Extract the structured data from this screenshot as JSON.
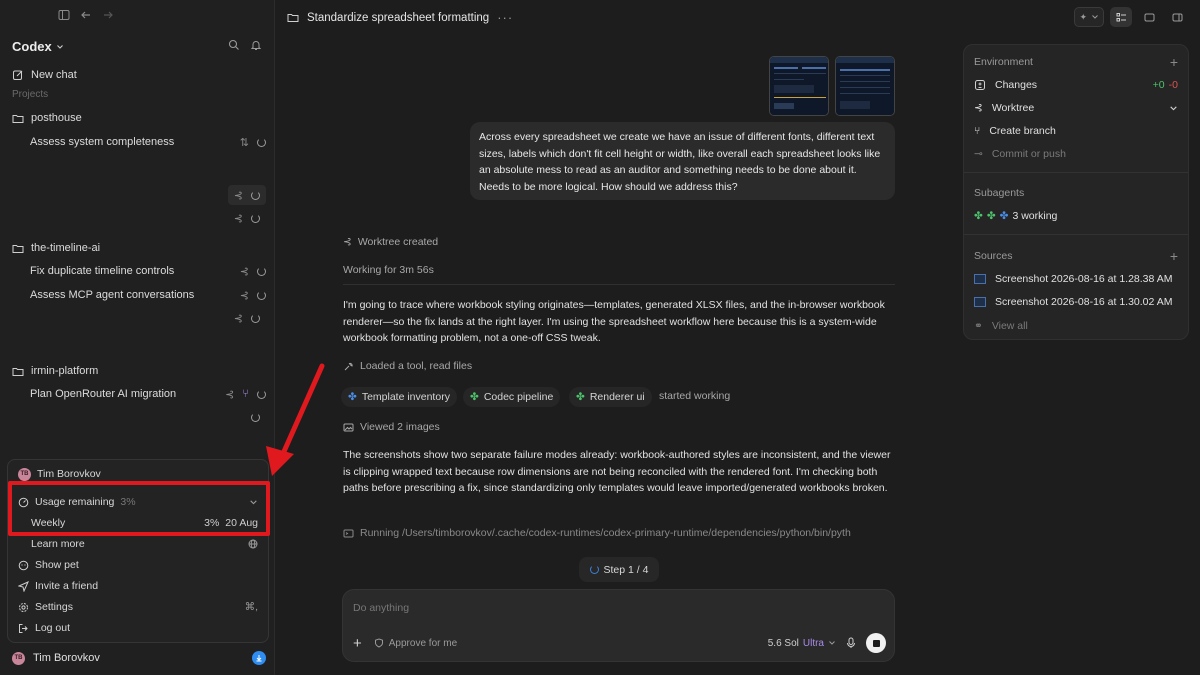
{
  "sidebar": {
    "brand": "Codex",
    "new_chat": "New chat",
    "projects_label": "Projects",
    "groups": [
      {
        "name": "posthouse",
        "items": [
          "Assess system completeness"
        ]
      },
      {
        "name": "the-timeline-ai",
        "items": [
          "Fix duplicate timeline controls",
          "Assess MCP agent conversations"
        ]
      },
      {
        "name": "irmin-platform",
        "items": [
          "Plan OpenRouter AI migration"
        ]
      }
    ],
    "user": "Tim Borovkov",
    "user_initials": "TB"
  },
  "popup": {
    "user": "Tim Borovkov",
    "usage_label": "Usage remaining",
    "usage_pct": "3%",
    "weekly_label": "Weekly",
    "weekly_pct": "3%",
    "weekly_date": "20 Aug",
    "learn_more": "Learn more",
    "show_pet": "Show pet",
    "invite": "Invite a friend",
    "settings": "Settings",
    "settings_shortcut": "⌘,",
    "logout": "Log out"
  },
  "header": {
    "title": "Standardize spreadsheet formatting"
  },
  "chat": {
    "user_message": "Across every spreadsheet we create we have an issue of different fonts, different text sizes, labels which don't fit cell height or width, like overall each spreadsheet looks like an absolute mess to read as an auditor and something needs to be done about it. Needs to be more logical. How should we address this?",
    "worktree_created": "Worktree created",
    "working_for": "Working for 3m 56s",
    "para1": "I'm going to trace where workbook styling originates—templates, generated XLSX files, and the in-browser workbook renderer—so the fix lands at the right layer. I'm using the spreadsheet workflow here because this is a system-wide workbook formatting problem, not a one-off CSS tweak.",
    "loaded_tool": "Loaded a tool, read files",
    "chips": [
      "Template inventory",
      "Codec pipeline",
      "Renderer ui"
    ],
    "started_working": "started working",
    "viewed_images": "Viewed 2 images",
    "para2": "The screenshots show two separate failure modes already: workbook-authored styles are inconsistent, and the viewer is clipping wrapped text because row dimensions are not being reconciled with the rendered font. I'm checking both paths before prescribing a fix, since standardizing only templates would leave imported/generated workbooks broken.",
    "running": "Running /Users/timborovkov/.cache/codex-runtimes/codex-primary-runtime/dependencies/python/bin/pyth",
    "step": "Step 1 / 4"
  },
  "composer": {
    "placeholder": "Do anything",
    "approve": "Approve for me",
    "model": "5.6 Sol",
    "model_tier": "Ultra"
  },
  "panel": {
    "environment": "Environment",
    "changes": "Changes",
    "added": "+0",
    "removed": "-0",
    "worktree": "Worktree",
    "create_branch": "Create branch",
    "commit_push": "Commit or push",
    "subagents": "Subagents",
    "working": "3 working",
    "sources": "Sources",
    "source_files": [
      "Screenshot 2026-08-16 at 1.28.38 AM",
      "Screenshot 2026-08-16 at 1.30.02 AM"
    ],
    "view_all": "View all"
  },
  "colors": {
    "accent_red": "#e0191f",
    "added_green": "#4cc26a",
    "removed_red": "#e0524f",
    "ultra_purple": "#a98be8"
  }
}
